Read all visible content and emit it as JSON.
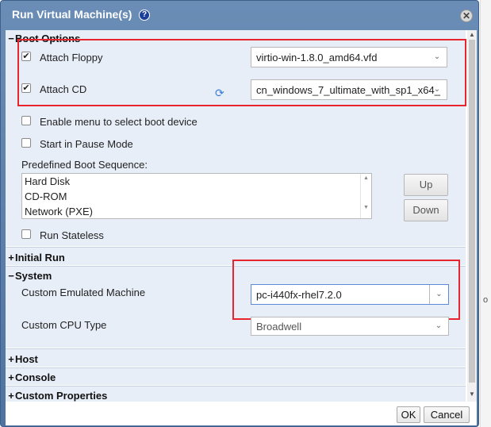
{
  "dialog": {
    "title": "Run Virtual Machine(s)",
    "help_glyph": "?",
    "close_glyph": "✕"
  },
  "boot_options": {
    "heading": "Boot Options",
    "sign": "−",
    "attach_floppy": {
      "label": "Attach Floppy",
      "checked": true,
      "value": "virtio-win-1.8.0_amd64.vfd"
    },
    "attach_cd": {
      "label": "Attach CD",
      "checked": true,
      "value": "cn_windows_7_ultimate_with_sp1_x64_"
    },
    "enable_menu": {
      "label": "Enable menu to select boot device",
      "checked": false
    },
    "start_paused": {
      "label": "Start in Pause Mode",
      "checked": false
    },
    "boot_sequence_label": "Predefined Boot Sequence:",
    "boot_sequence": [
      "Hard Disk",
      "CD-ROM",
      "Network (PXE)"
    ],
    "up_label": "Up",
    "down_label": "Down",
    "run_stateless": {
      "label": "Run Stateless",
      "checked": false
    }
  },
  "initial_run": {
    "heading": "Initial Run",
    "sign": "+"
  },
  "system": {
    "heading": "System",
    "sign": "−",
    "emulated_machine_label": "Custom Emulated Machine",
    "emulated_machine_value": "pc-i440fx-rhel7.2.0",
    "cpu_type_label": "Custom CPU Type",
    "cpu_type_value": "Broadwell"
  },
  "host": {
    "heading": "Host",
    "sign": "+"
  },
  "console": {
    "heading": "Console",
    "sign": "+"
  },
  "custom_properties": {
    "heading": "Custom Properties",
    "sign": "+"
  },
  "footer": {
    "ok_label": "OK",
    "cancel_label": "Cancel"
  },
  "side_edge_glyph": "o",
  "icons": [
    "help-icon",
    "close-icon",
    "refresh-icon",
    "chevron-down-icon",
    "checkbox"
  ],
  "colors": {
    "titlebar": "#5a7eab",
    "panel": "#e8eef8",
    "highlight": "#e8242f"
  }
}
